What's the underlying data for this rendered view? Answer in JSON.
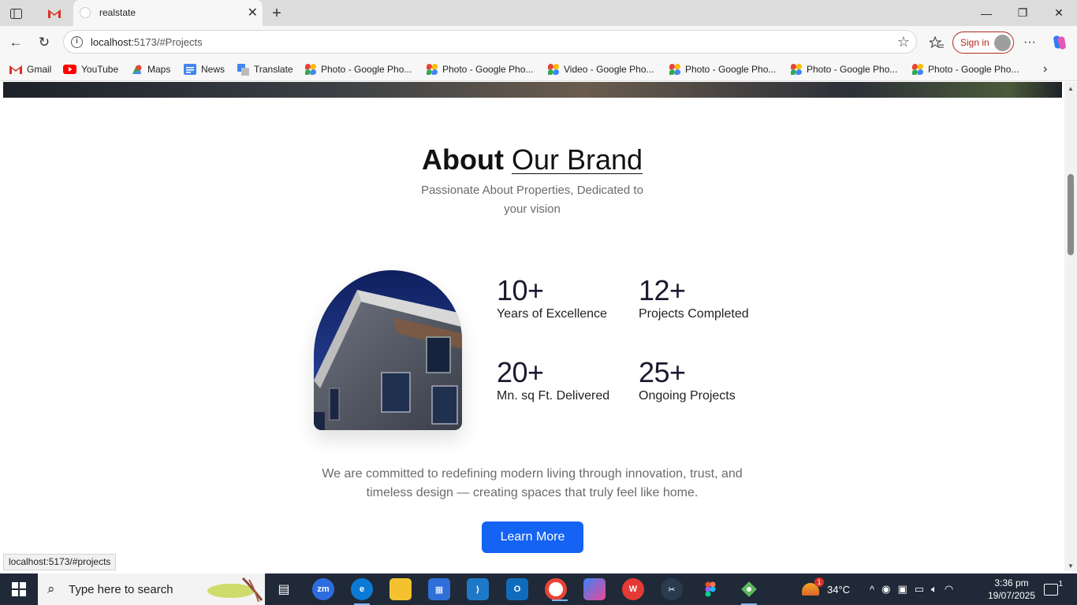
{
  "browser": {
    "tab_title": "realstate",
    "url_host": "localhost:",
    "url_rest": "5173/#Projects",
    "signin_label": "Sign in",
    "status_url": "localhost:5173/#projects"
  },
  "bookmarks": [
    {
      "label": "Gmail",
      "icon": "gmail-icon"
    },
    {
      "label": "YouTube",
      "icon": "youtube-icon"
    },
    {
      "label": "Maps",
      "icon": "maps-icon"
    },
    {
      "label": "News",
      "icon": "news-icon"
    },
    {
      "label": "Translate",
      "icon": "translate-icon"
    },
    {
      "label": "Photo - Google Pho...",
      "icon": "google-photos-icon"
    },
    {
      "label": "Photo - Google Pho...",
      "icon": "google-photos-icon"
    },
    {
      "label": "Video - Google Pho...",
      "icon": "google-photos-icon"
    },
    {
      "label": "Photo - Google Pho...",
      "icon": "google-photos-icon"
    },
    {
      "label": "Photo - Google Pho...",
      "icon": "google-photos-icon"
    },
    {
      "label": "Photo - Google Pho...",
      "icon": "google-photos-icon"
    }
  ],
  "about": {
    "heading_bold": "About",
    "heading_underlined": "Our Brand",
    "subtitle": "Passionate About Properties, Dedicated to your vision",
    "stats": [
      {
        "value": "10+",
        "label": "Years of Excellence"
      },
      {
        "value": "12+",
        "label": "Projects Completed"
      },
      {
        "value": "20+",
        "label": "Mn. sq Ft. Delivered"
      },
      {
        "value": "25+",
        "label": "Ongoing Projects"
      }
    ],
    "description": "We are committed to redefining modern living through innovation, trust, and timeless design — creating spaces that truly feel like home.",
    "button_label": "Learn More"
  },
  "taskbar": {
    "search_placeholder": "Type here to search",
    "weather": "34°C",
    "weather_badge": "1",
    "time": "3:36 pm",
    "date": "19/07/2025",
    "notification_count": "1"
  },
  "colors": {
    "accent_button": "#1463f3",
    "heading": "#111111",
    "muted_text": "#6b6b6b"
  }
}
